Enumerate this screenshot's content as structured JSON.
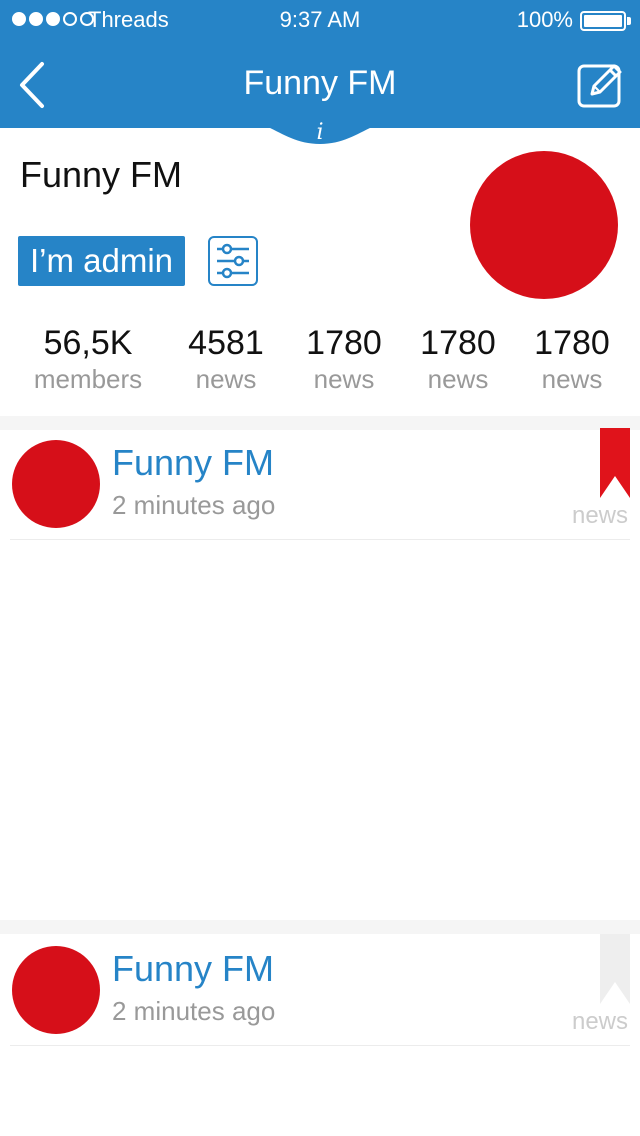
{
  "status_bar": {
    "carrier": "Threads",
    "time": "9:37 AM",
    "battery": "100%"
  },
  "nav": {
    "title": "Funny FM",
    "info_glyph": "i",
    "back_icon": "chevron-left-icon",
    "edit_icon": "edit-icon"
  },
  "profile": {
    "name": "Funny FM",
    "admin_label": "I’m admin",
    "settings_icon": "sliders-icon",
    "avatar_color": "#d60f19"
  },
  "stats": [
    {
      "value": "56,5K",
      "label": "members"
    },
    {
      "value": "4581",
      "label": "news"
    },
    {
      "value": "1780",
      "label": "news"
    },
    {
      "value": "1780",
      "label": "news"
    },
    {
      "value": "1780",
      "label": "news"
    }
  ],
  "feed": [
    {
      "title": "Funny FM",
      "time": "2 minutes ago",
      "tag": "news",
      "bookmarked": true
    },
    {
      "title": "Funny FM",
      "time": "2 minutes ago",
      "tag": "news",
      "bookmarked": false
    }
  ],
  "colors": {
    "accent": "#2684c7",
    "avatar": "#d60f19",
    "bookmark_active": "#e0131b",
    "bookmark_inactive": "#eeeeee",
    "muted_text": "#999999"
  }
}
